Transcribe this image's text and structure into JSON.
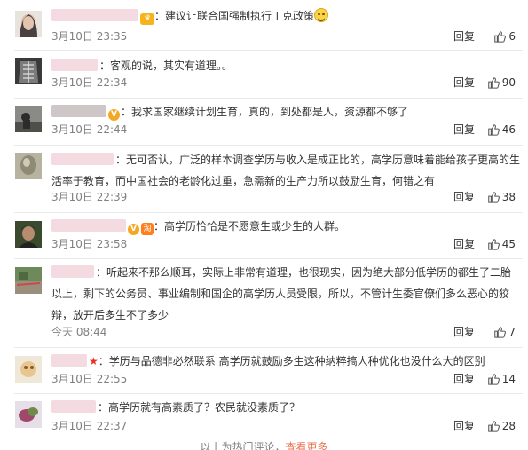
{
  "comments": [
    {
      "text": "：建议让联合国强制执行丁克政策",
      "time": "3月10日 23:35",
      "reply_label": "回复",
      "likes": "6",
      "badges": [
        "crown"
      ],
      "emoji": "grinning-sweat-emoji"
    },
    {
      "text": "：客观的说，其实有道理。。",
      "time": "3月10日 22:34",
      "reply_label": "回复",
      "likes": "90"
    },
    {
      "text": "：我求国家继续计划生育，真的，到处都是人，资源都不够了",
      "time": "3月10日 22:44",
      "reply_label": "回复",
      "likes": "46",
      "badges": [
        "v"
      ]
    },
    {
      "text": "：无可否认，广泛的样本调查学历与收入是成正比的，高学历意味着能给孩子更高的生活率于教育，而中国社会的老龄化过重，急需新的生产力所以鼓励生育，何错之有",
      "time": "3月10日 22:39",
      "reply_label": "回复",
      "likes": "38"
    },
    {
      "text": "：高学历恰恰是不愿意生或少生的人群。",
      "time": "3月10日 23:58",
      "reply_label": "回复",
      "likes": "45",
      "badges": [
        "v",
        "tao"
      ]
    },
    {
      "text": "：听起来不那么顺耳，实际上非常有道理，也很现实，因为绝大部分低学历的都生了二胎以上，剩下的公务员、事业编制和国企的高学历人员受限，所以，不管计生委官僚们多么恶心的狡辩，放开后多生不了多少",
      "time": "今天 08:44",
      "reply_label": "回复",
      "likes": "7"
    },
    {
      "text": "：学历与品德非必然联系 高学历就鼓励多生这种纳粹搞人种优化也没什么大的区别",
      "time": "3月10日 22:55",
      "reply_label": "回复",
      "likes": "14",
      "badges": [
        "star"
      ]
    },
    {
      "text": "：高学历就有高素质了？农民就没素质了？",
      "time": "3月10日 22:37",
      "reply_label": "回复",
      "likes": "28"
    }
  ],
  "footer": {
    "text": "以上为热门评论，",
    "more": "查看更多"
  },
  "colors": {
    "link": "#eb7350",
    "time": "#808080",
    "divider": "#eaeaea"
  }
}
